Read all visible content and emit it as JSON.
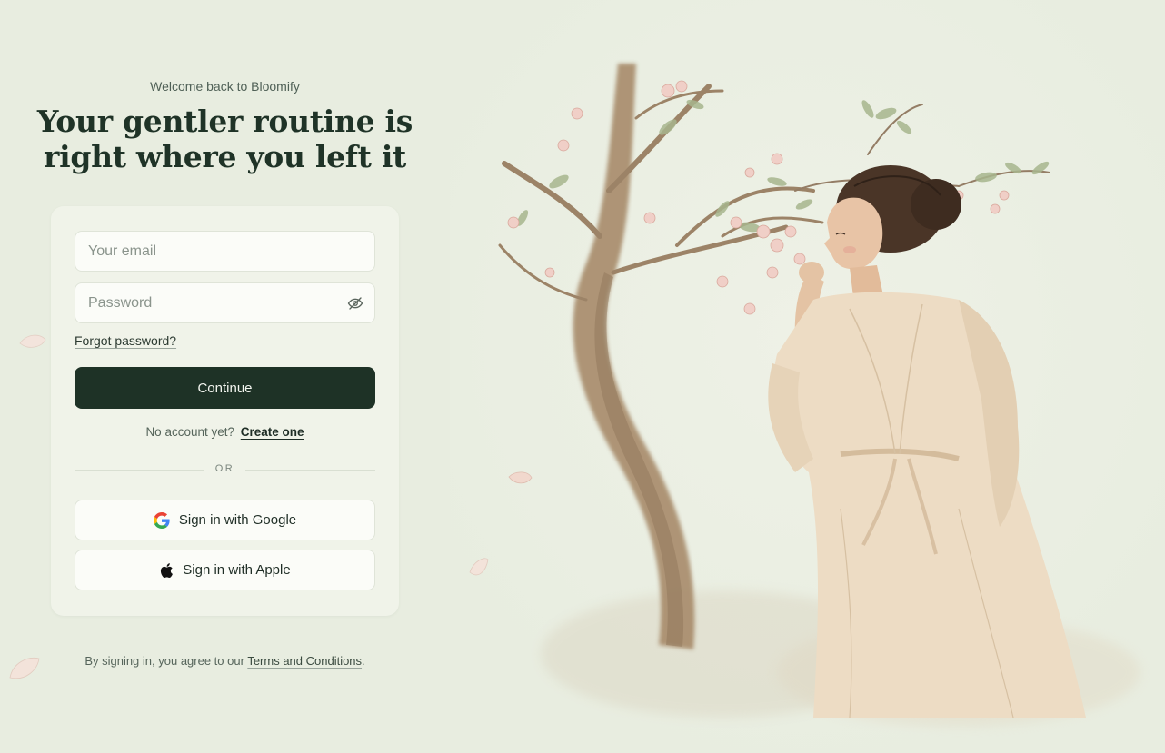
{
  "header": {
    "welcome": "Welcome back to Bloomify",
    "headline_line1": "Your gentler routine is",
    "headline_line2": "right where you left it"
  },
  "form": {
    "email_placeholder": "Your email",
    "password_placeholder": "Password",
    "forgot_label": "Forgot password?",
    "continue_label": "Continue",
    "no_account_text": "No account yet?",
    "create_label": "Create one",
    "divider_label": "OR",
    "google_label": "Sign in with Google",
    "apple_label": "Sign in with Apple"
  },
  "footer": {
    "terms_prefix": "By signing in, you agree to our",
    "terms_link": "Terms and Conditions",
    "terms_suffix": "."
  },
  "icons": {
    "password_toggle": "eye-off-icon",
    "google": "google-icon",
    "apple": "apple-icon"
  },
  "colors": {
    "page_background": "#e8ede0",
    "card_background": "#f0f3e9",
    "primary_button": "#1e3226",
    "headline_text": "#1f3327"
  }
}
